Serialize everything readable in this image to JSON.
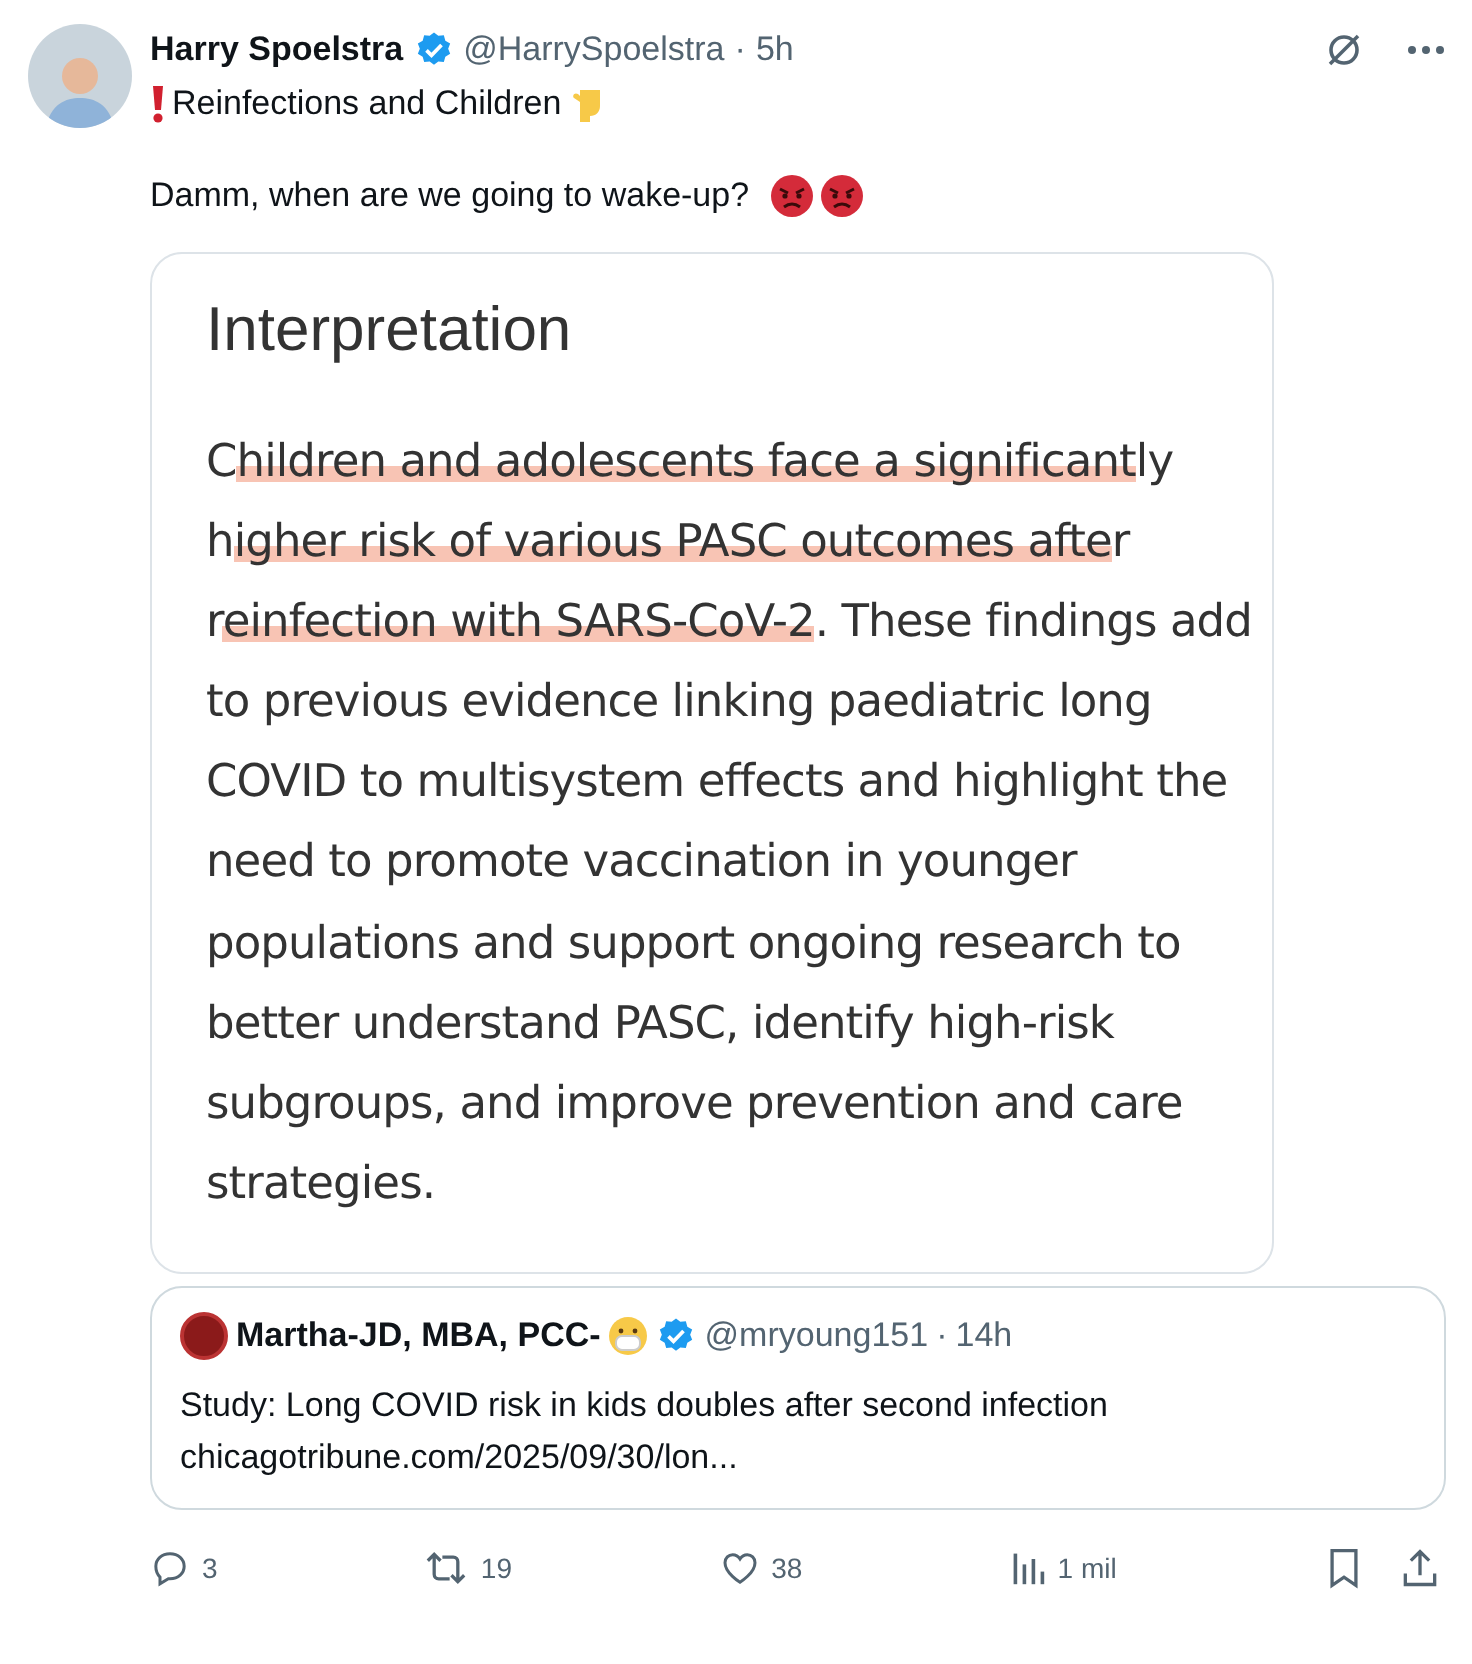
{
  "post": {
    "author": "Harry Spoelstra",
    "verified": true,
    "handle": "@HarrySpoelstra",
    "separator": "·",
    "time": "5h",
    "text_lines": [
      "Reinfections and Children",
      "Damm, when are we going to wake-up?"
    ]
  },
  "document": {
    "heading": "Interpretation",
    "paragraph": [
      {
        "text": "C",
        "highlighted": false
      },
      {
        "text": "hildren and adolescents face a significant",
        "highlighted": true
      },
      {
        "text": "ly h",
        "highlighted": false
      },
      {
        "text": "igher risk of various PASC outcomes afte",
        "highlighted": true
      },
      {
        "text": "r r",
        "highlighted": false
      },
      {
        "text": "einfection with SARS-CoV-2",
        "highlighted": true
      },
      {
        "text": ". These findings add to previous evidence linking paediatric long COVID to multisystem effects and highlight the need to promote vaccination in younger populations and support ongoing research to better understand PASC, identify high-risk subgroups, and improve prevention and care strategies.",
        "highlighted": false
      }
    ]
  },
  "quote": {
    "author": "Martha-JD, MBA, PCC-",
    "verified": true,
    "handle": "@mryoung151",
    "separator": "·",
    "time": "14h",
    "text": "Study: Long COVID risk in kids doubles after second infection",
    "link": "chicagotribune.com/2025/09/30/lon..."
  },
  "actions": [
    {
      "kind": "reply",
      "count": "3"
    },
    {
      "kind": "repost",
      "count": "19"
    },
    {
      "kind": "like",
      "count": "38"
    },
    {
      "kind": "views",
      "count": "1 mil"
    },
    {
      "kind": "bookmark"
    },
    {
      "kind": "share"
    }
  ]
}
